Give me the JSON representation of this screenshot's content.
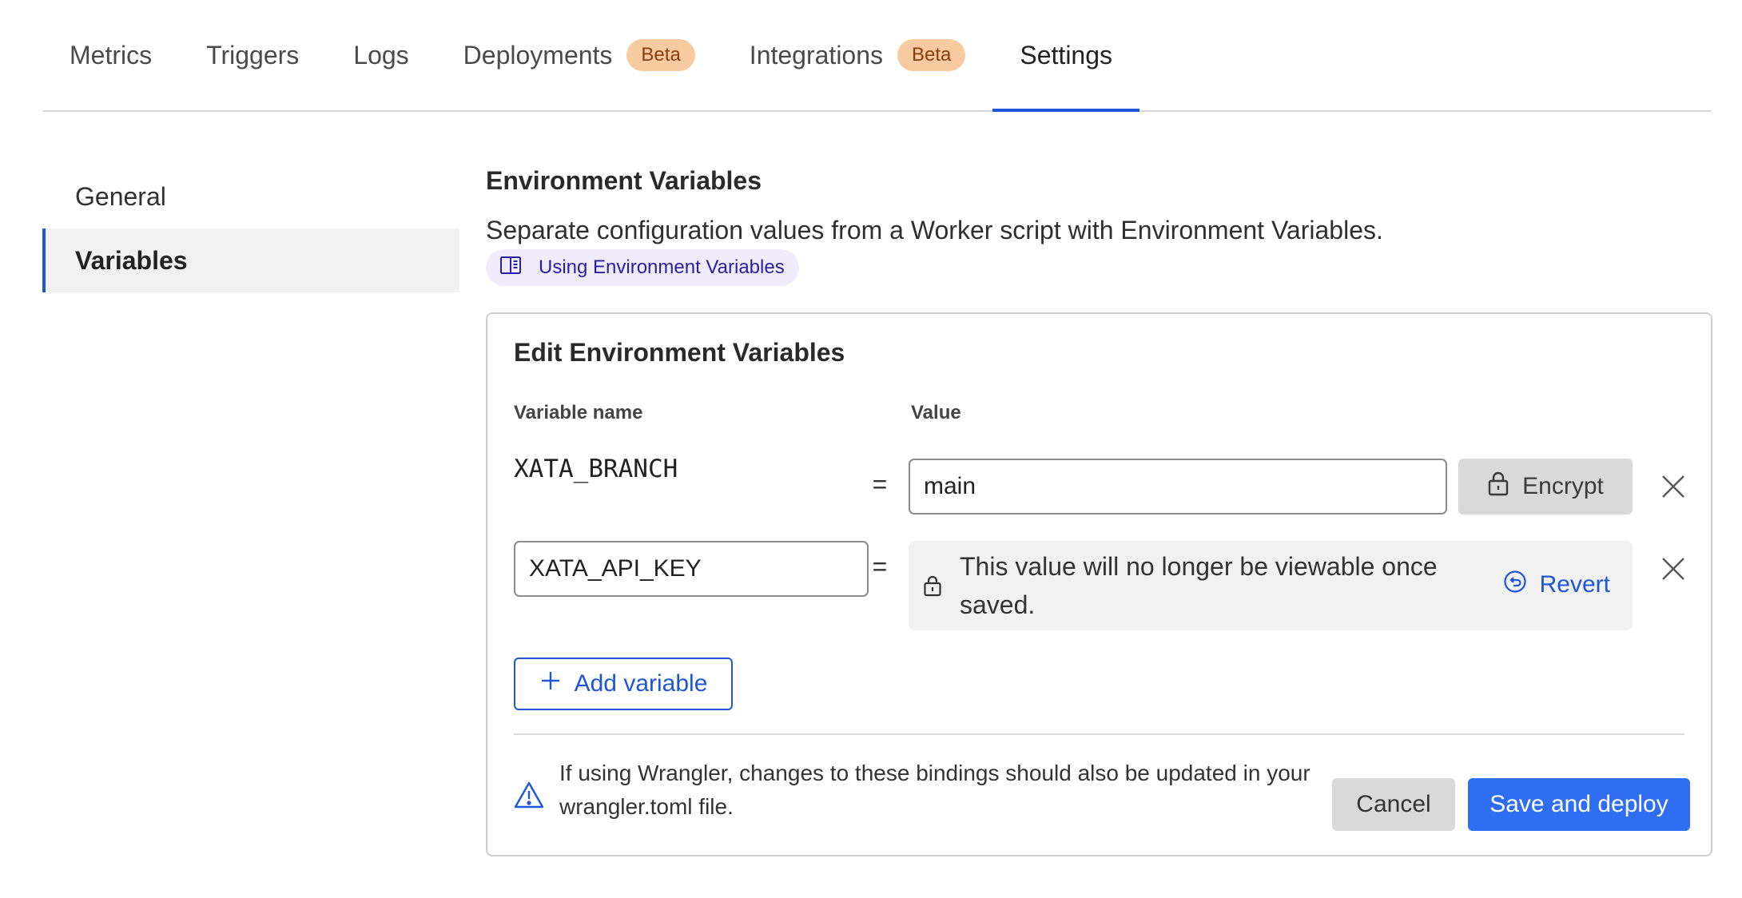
{
  "tabs": [
    {
      "label": "Metrics",
      "badge": ""
    },
    {
      "label": "Triggers",
      "badge": ""
    },
    {
      "label": "Logs",
      "badge": ""
    },
    {
      "label": "Deployments",
      "badge": "Beta"
    },
    {
      "label": "Integrations",
      "badge": "Beta"
    },
    {
      "label": "Settings",
      "badge": "",
      "active": true
    }
  ],
  "sidebar": {
    "items": [
      {
        "label": "General"
      },
      {
        "label": "Variables",
        "active": true
      }
    ]
  },
  "main": {
    "title": "Environment Variables",
    "description": "Separate configuration values from a Worker script with Environment Variables.",
    "doc_link": "Using Environment Variables"
  },
  "card": {
    "title": "Edit Environment Variables",
    "col_name": "Variable name",
    "col_value": "Value",
    "equals": "=",
    "rows": [
      {
        "name": "XATA_BRANCH",
        "value": "main",
        "encrypt_label": "Encrypt"
      },
      {
        "name": "XATA_API_KEY",
        "encrypted_message": "This value will no longer be viewable once saved.",
        "revert_label": "Revert"
      }
    ],
    "add_label": "Add variable",
    "warning": "If using Wrangler, changes to these bindings should also be updated in your wrangler.toml file.",
    "cancel_label": "Cancel",
    "save_label": "Save and deploy"
  },
  "colors": {
    "accent": "#1f56d8",
    "primary_button": "#2f6ef2",
    "badge_bg": "#f8caa0",
    "badge_text": "#8a3d0b",
    "doc_link_bg": "#f0ecfb",
    "doc_link_text": "#2b1ea6"
  },
  "icons": {
    "doc_link": "book-icon",
    "encrypt": "lock-icon",
    "remove": "close-icon",
    "revert": "revert-icon",
    "add": "plus-icon",
    "warning": "warning-triangle-icon"
  }
}
